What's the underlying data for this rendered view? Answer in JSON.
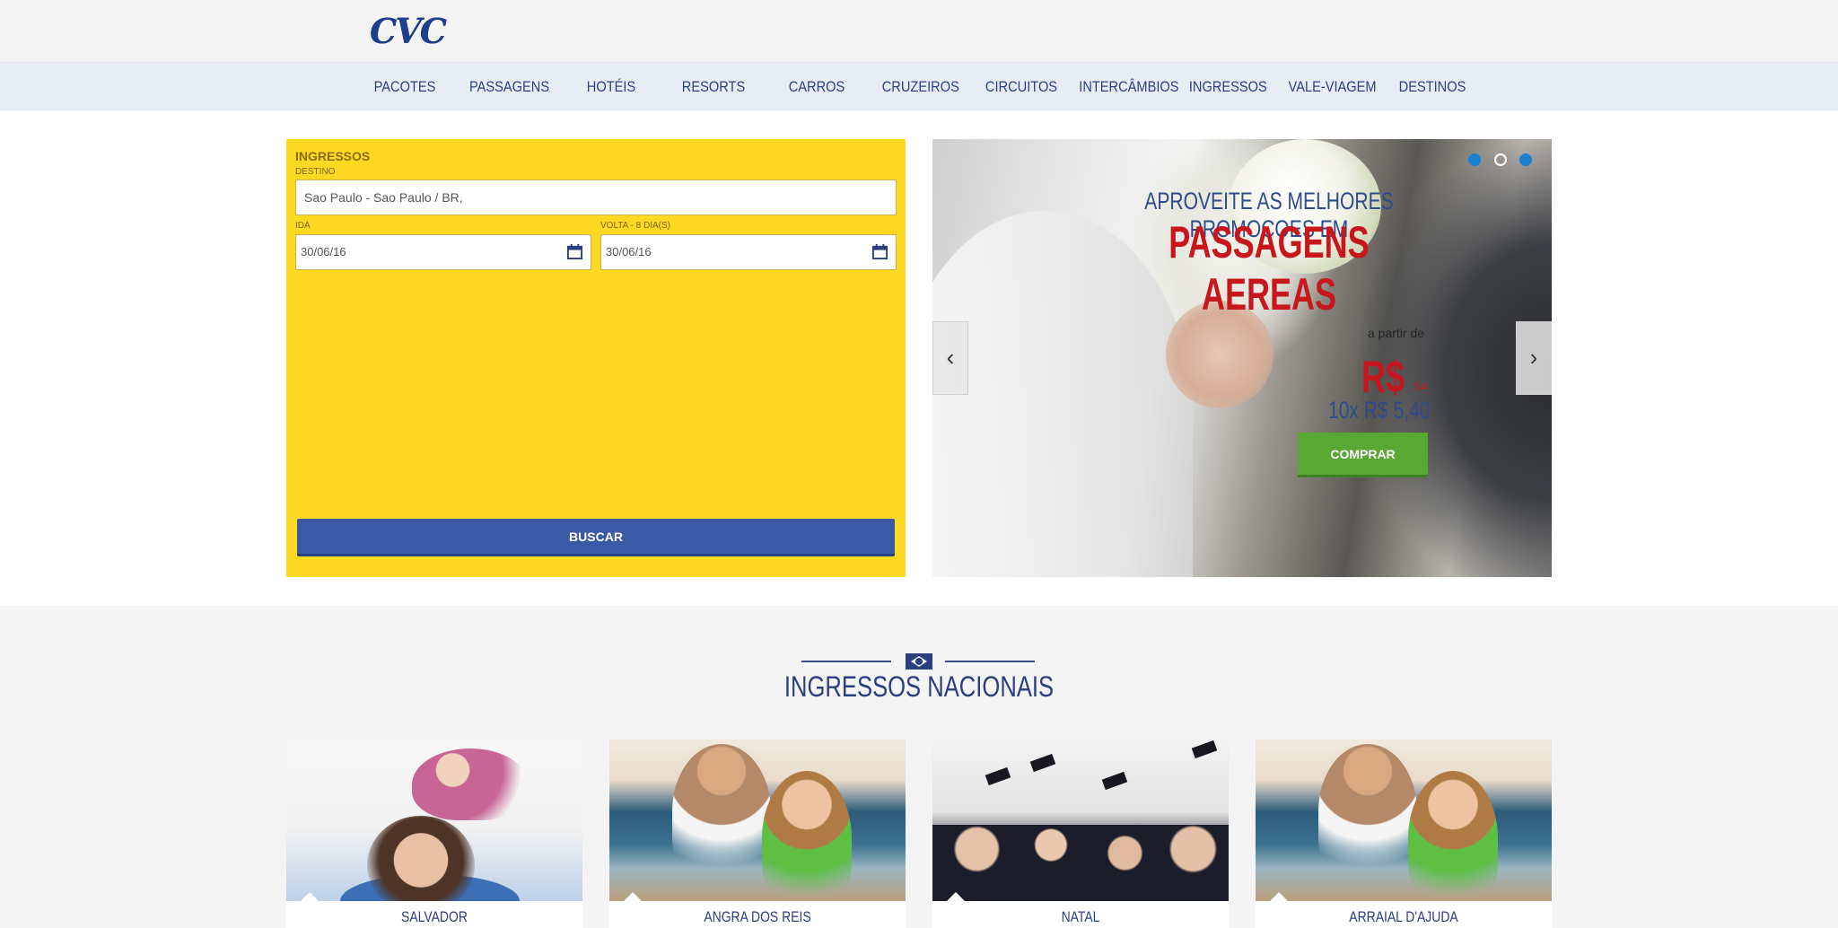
{
  "brand": {
    "logo_text": "CVC"
  },
  "nav": {
    "items": [
      {
        "label": "PACOTES"
      },
      {
        "label": "PASSAGENS"
      },
      {
        "label": "HOTÉIS"
      },
      {
        "label": "RESORTS"
      },
      {
        "label": "CARROS"
      },
      {
        "label": "CRUZEIROS"
      },
      {
        "label": "CIRCUITOS"
      },
      {
        "label": "INTERCÂMBIOS"
      },
      {
        "label": "INGRESSOS"
      },
      {
        "label": "VALE-VIAGEM"
      },
      {
        "label": "DESTINOS"
      }
    ]
  },
  "search": {
    "title": "INGRESSOS",
    "destino_label": "DESTINO",
    "destino_value": "Sao Paulo - Sao Paulo / BR,",
    "ida_label": "IDA",
    "ida_value": "30/06/16",
    "volta_label": "VOLTA - 8 DIA(S)",
    "volta_value": "30/06/16",
    "button_label": "BUSCAR",
    "calendar_icon": "calendar-icon"
  },
  "banner": {
    "headline": "APROVEITE AS MELHORES PROMOCOES EM",
    "product": "PASSAGENS AEREAS",
    "from_label": "a partir de",
    "price_currency": "R$",
    "price_cents": "54",
    "installments": "10x R$ 5,40",
    "cta_label": "COMPRAR",
    "prev_icon": "chevron-left-icon",
    "next_icon": "chevron-right-icon",
    "prev_glyph": "‹",
    "next_glyph": "›",
    "slides": [
      {
        "active": true
      },
      {
        "active": false
      },
      {
        "active": true
      }
    ],
    "colors": {
      "price": "#c8161d",
      "cta": "#5aa834",
      "dot_active": "#1b7fd2"
    }
  },
  "section": {
    "title": "INGRESSOS NACIONAIS",
    "flag_icon": "brazil-flag-icon"
  },
  "cards": [
    {
      "name": "SALVADOR"
    },
    {
      "name": "ANGRA DOS REIS"
    },
    {
      "name": "NATAL"
    },
    {
      "name": "ARRAIAL D'AJUDA"
    }
  ],
  "colors": {
    "primary_blue": "#2b3f80",
    "search_yellow": "#fdd922",
    "button_blue": "#3a5aa6",
    "nav_bg": "#e8ecf5"
  }
}
